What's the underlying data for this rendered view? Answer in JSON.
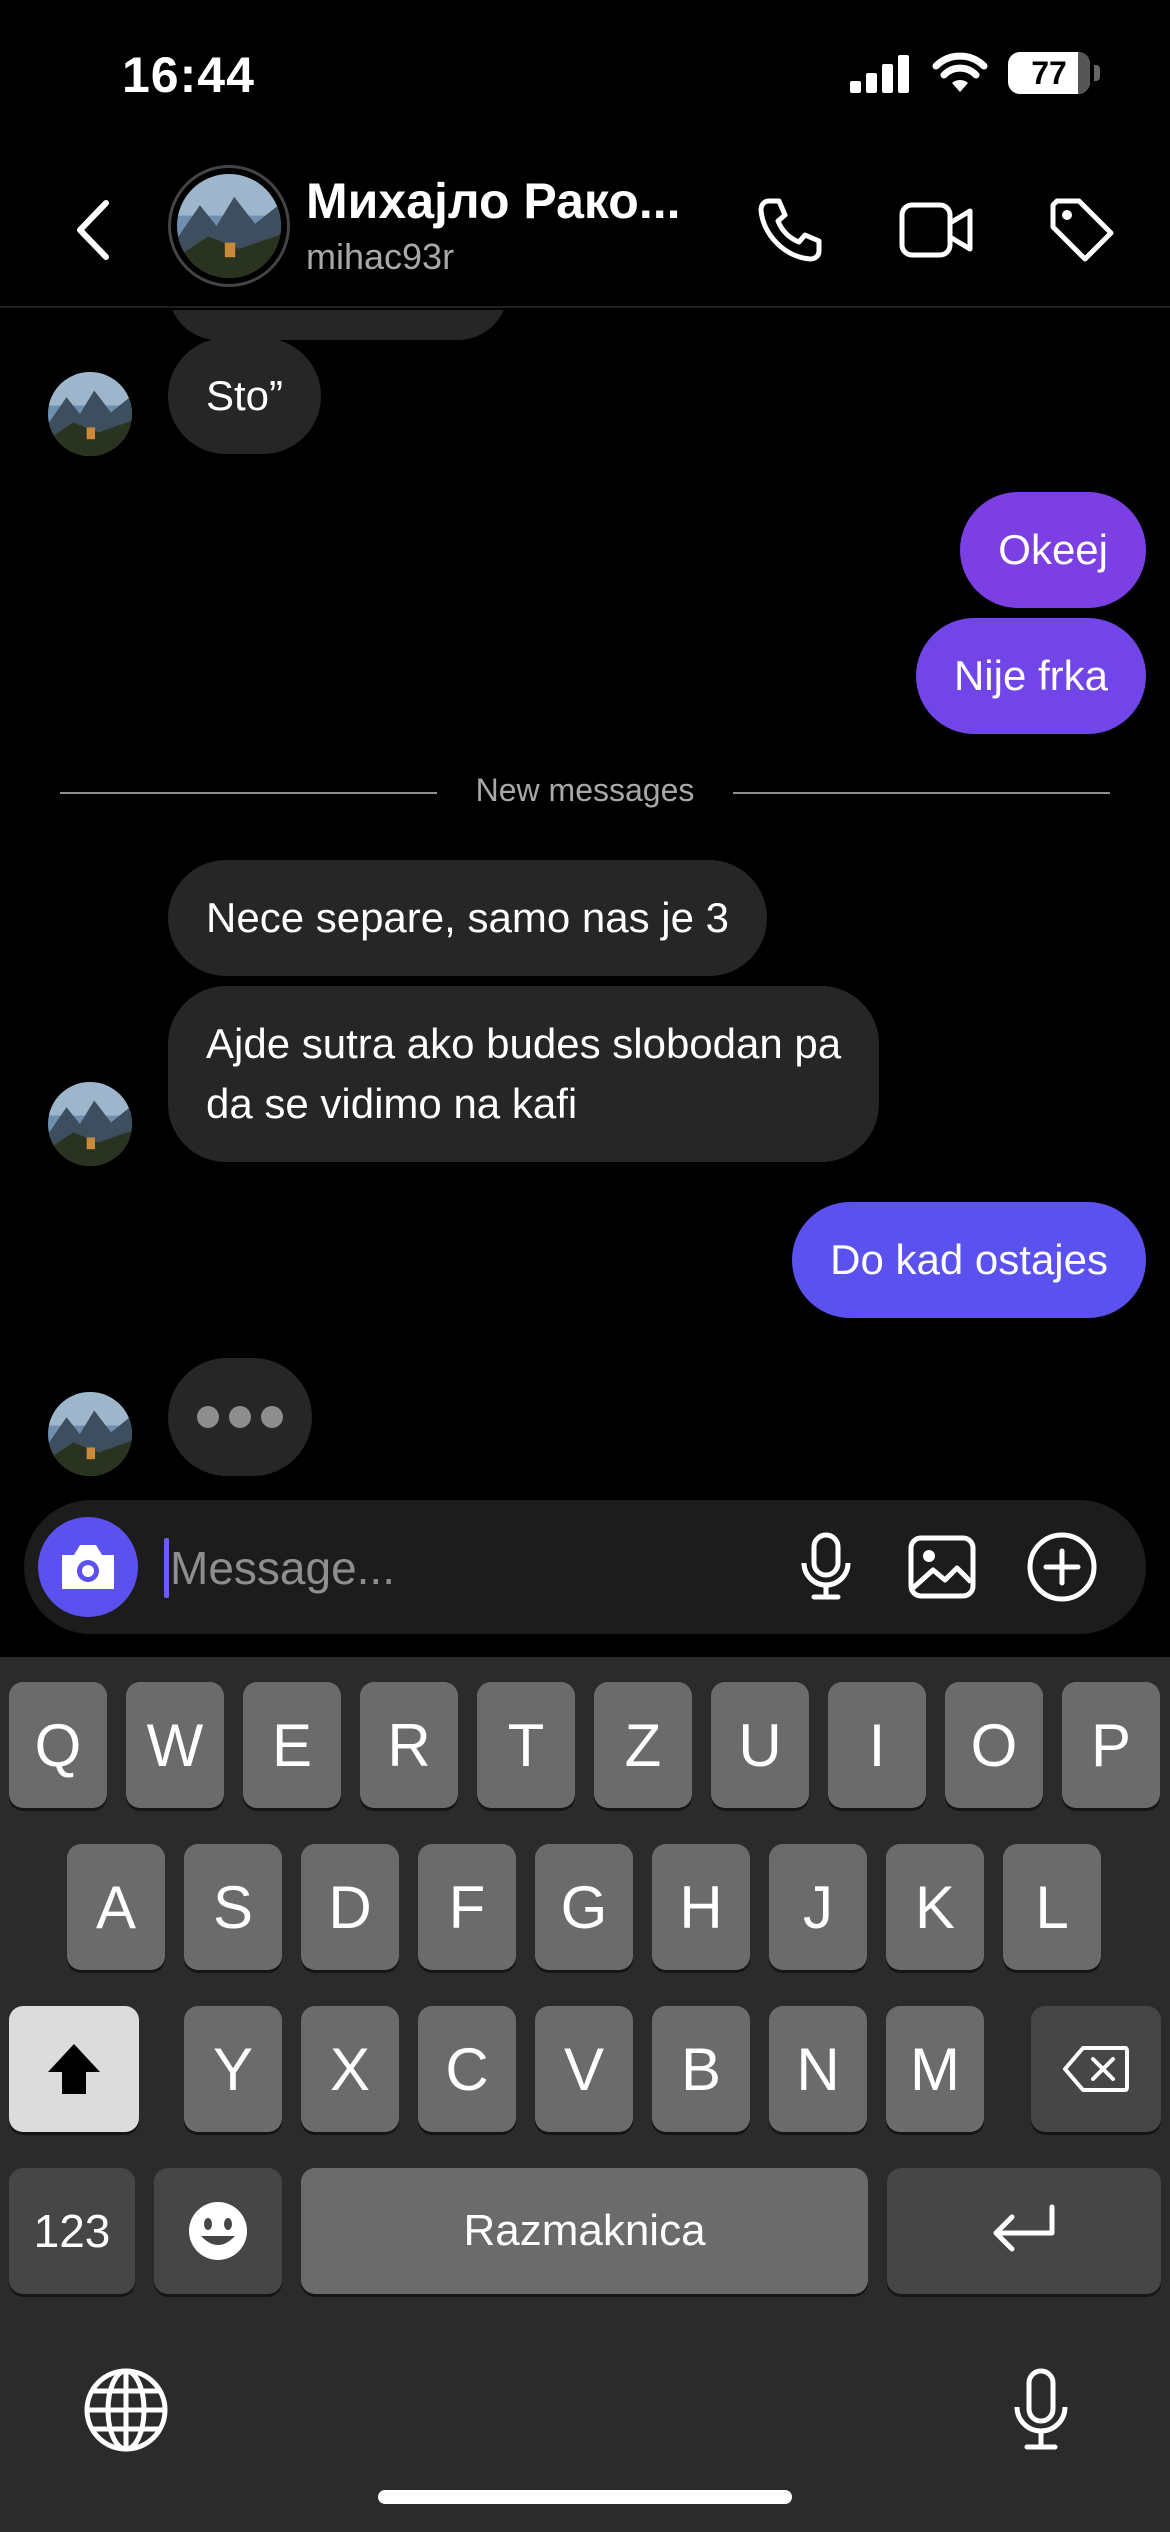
{
  "status_bar": {
    "time": "16:44",
    "battery": "77"
  },
  "header": {
    "contact_name": "Михајло Рако...",
    "username": "mihac93r"
  },
  "messages": {
    "incoming_1": "Sto”",
    "outgoing_1": "Okeej",
    "outgoing_2": "Nije frka",
    "divider": "New messages",
    "incoming_2": "Nece separe, samo nas je 3",
    "incoming_3_line1": "Ajde sutra ako budes slobodan pa",
    "incoming_3_line2": "da se vidimo na kafi",
    "outgoing_3": "Do kad ostajes"
  },
  "composer": {
    "placeholder": "Message..."
  },
  "keyboard": {
    "row1": [
      "Q",
      "W",
      "E",
      "R",
      "T",
      "Z",
      "U",
      "I",
      "O",
      "P"
    ],
    "row2": [
      "A",
      "S",
      "D",
      "F",
      "G",
      "H",
      "J",
      "K",
      "L"
    ],
    "row3": [
      "Y",
      "X",
      "C",
      "V",
      "B",
      "N",
      "M"
    ],
    "numbers_label": "123",
    "space_label": "Razmaknica"
  },
  "colors": {
    "accent": "#5b51ef",
    "bubble_out_top": "#7b3fe4",
    "bubble_out_bottom": "#5b51ef",
    "bubble_in": "#262626"
  }
}
